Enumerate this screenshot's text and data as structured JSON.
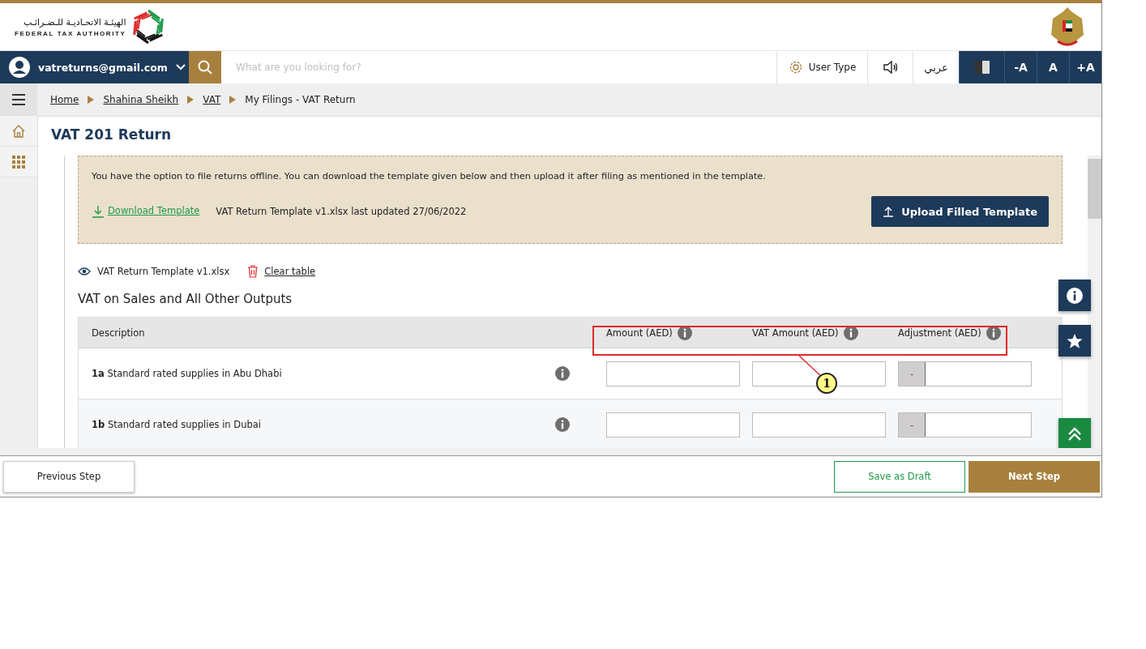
{
  "header": {
    "logo_arabic": "الهيئـة الاتحـاديـة للـضـرائـب",
    "logo_english": "FEDERAL TAX AUTHORITY"
  },
  "nav": {
    "user_email": "vatreturns@gmail.com",
    "search_placeholder": "What are you looking for?",
    "user_type": "User Type",
    "language": "عربي",
    "font_buttons": [
      "-A",
      "A",
      "+A"
    ]
  },
  "breadcrumbs": [
    {
      "label": "Home",
      "link": true
    },
    {
      "label": "Shahina Sheikh",
      "link": true
    },
    {
      "label": "VAT",
      "link": true
    },
    {
      "label": "My Filings - VAT Return",
      "link": false
    }
  ],
  "page_title": "VAT 201 Return",
  "offline_notice": {
    "text": "You have the option to file returns offline. You can download the template given below and then upload it after filing as mentioned in the template.",
    "download_link": "Download Template",
    "template_info": "VAT Return Template v1.xlsx last updated 27/06/2022",
    "upload_button": "Upload Filled Template"
  },
  "file_bar": {
    "file_name": "VAT Return Template v1.xlsx",
    "clear_link": "Clear table"
  },
  "section_title": "VAT on Sales and All Other Outputs",
  "table": {
    "columns": [
      "Description",
      "Amount (AED)",
      "VAT Amount (AED)",
      "Adjustment (AED)"
    ],
    "rows": [
      {
        "code": "1a",
        "description": "Standard rated supplies in Abu Dhabi",
        "adjustment_sign": "-"
      },
      {
        "code": "1b",
        "description": "Standard rated supplies in Dubai",
        "adjustment_sign": "-"
      }
    ]
  },
  "annotation": {
    "label": "1"
  },
  "footer": {
    "previous": "Previous Step",
    "save": "Save as Draft",
    "next": "Next Step"
  }
}
